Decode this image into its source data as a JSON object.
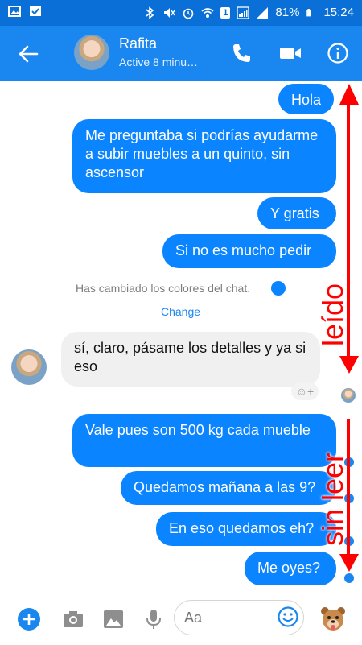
{
  "statusbar": {
    "battery": "81%",
    "time": "15:24",
    "sim_badge": "1",
    "icons": [
      "photo-icon",
      "check-flag-icon",
      "bluetooth-icon",
      "mute-icon",
      "alarm-icon",
      "wifi-icon",
      "sim-icon",
      "signal-icon",
      "battery-icon"
    ]
  },
  "header": {
    "contact_name": "Rafita",
    "status": "Active 8 minu…",
    "icons": [
      "back-arrow-icon",
      "phone-icon",
      "video-call-icon",
      "info-icon"
    ]
  },
  "messages": [
    {
      "side": "out",
      "text": "Hola"
    },
    {
      "side": "out",
      "text": "Me preguntaba si podrías ayudarme a subir muebles a un quinto, sin ascensor"
    },
    {
      "side": "out",
      "text": "Y gratis"
    },
    {
      "side": "out",
      "text": "Si no es mucho pedir"
    },
    {
      "side": "in",
      "text": "sí, claro, pásame los detalles y ya si eso"
    },
    {
      "side": "out",
      "text": "Vale pues son 500 kg cada mueble"
    },
    {
      "side": "out",
      "text": "Quedamos mañana a las 9?"
    },
    {
      "side": "out",
      "text": "En eso quedamos eh?"
    },
    {
      "side": "out",
      "text": "Me oyes?"
    }
  ],
  "system_notice": {
    "text": "Has cambiado los colores del chat.",
    "action": "Change"
  },
  "annotations": {
    "read_label": "leído",
    "unread_label": "sin leer",
    "color": "#ff0000"
  },
  "composer": {
    "placeholder": "Aa",
    "icons": [
      "add-icon",
      "camera-icon",
      "image-icon",
      "microphone-icon",
      "emoji-icon",
      "sticker-icon"
    ]
  },
  "colors": {
    "appbar": "#1a87f0",
    "statusbar": "#0a6fd6",
    "outgoing_bubble": "#0b84ff",
    "incoming_bubble": "#f0f0f0"
  }
}
